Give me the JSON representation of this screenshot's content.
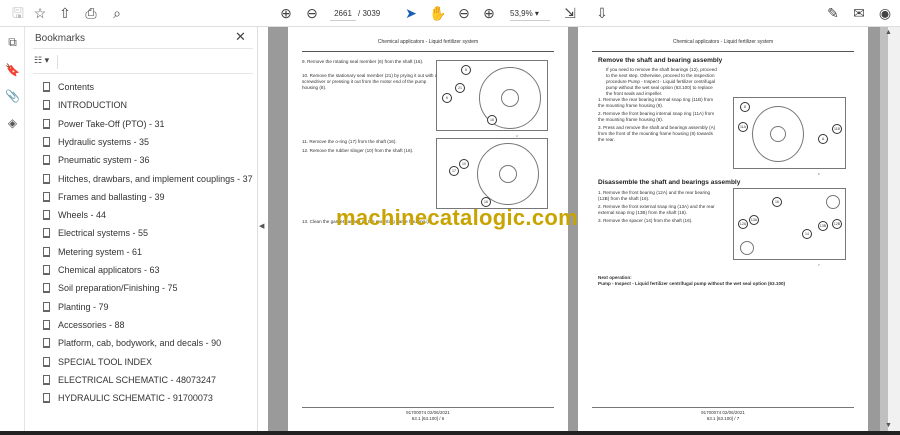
{
  "toolbar": {
    "page_current": "2661",
    "page_total": "/ 3039",
    "zoom": "53,9%"
  },
  "bookmarks": {
    "title": "Bookmarks",
    "items": [
      "Contents",
      "INTRODUCTION",
      "Power Take-Off (PTO) - 31",
      "Hydraulic systems - 35",
      "Pneumatic system - 36",
      "Hitches, drawbars, and implement couplings - 37",
      "Frames and ballasting - 39",
      "Wheels - 44",
      "Electrical systems - 55",
      "Metering system - 61",
      "Chemical applicators - 63",
      "Soil preparation/Finishing - 75",
      "Planting - 79",
      "Accessories - 88",
      "Platform, cab, bodywork, and decals - 90",
      "SPECIAL TOOL INDEX",
      "ELECTRICAL SCHEMATIC - 48073247",
      "HYDRAULIC SCHEMATIC - 91700073"
    ]
  },
  "page_left": {
    "header": "Chemical applicators - Liquid fertilizer system",
    "steps": [
      "9. Remove the rotating seal member (6) from the shaft (16).",
      "10. Remove the stationary seal member (21) by prying it out with a screwdriver or pressing it out from the motor end of the pump housing (8).",
      "11. Remove the o-ring (17) from the shaft (16).",
      "12. Remove the rubber slinger (10) from the shaft (16).",
      "13. Clean the gasket surface on the mounting frame housing (8)."
    ],
    "fig_nums": [
      "4",
      "5"
    ],
    "footer1": "91700074 02/06/2021",
    "footer2": "63.1 [63.100] / 6"
  },
  "page_right": {
    "header": "Chemical applicators - Liquid fertilizer system",
    "h1": "Remove the shaft and bearing assembly",
    "intro": "If you need to remove the shaft bearings (12), proceed to the next step. Otherwise, proceed to the inspection procedure Pump - Inspect - Liquid fertilizer centrifugal pump without the wet seal option (63.100) to replace the front seals and impeller.",
    "steps1": [
      "1. Remove the rear bearing internal snap ring (11B) from the mounting frame housing (8).",
      "2. Remove the front bearing internal snap ring (11A) from the mounting frame housing (8).",
      "3. Press and remove the shaft and bearings assembly (A) from the front of the mounting frame housing (8) towards the rear."
    ],
    "h2": "Disassemble the shaft and bearings assembly",
    "steps2": [
      "1. Remove the front bearing (12A) and the rear bearing (12B) from the shaft (16).",
      "2. Remove the front external snap ring (13A) and the rear external snap ring (13B) from the shaft (16).",
      "3. Remove the spacer (14) from the shaft (16)."
    ],
    "next_label": "Next operation:",
    "next_text": "Pump - Inspect - Liquid fertilizer centrifugal pump without the wet seal option (63.100)",
    "fig_nums": [
      "6",
      "7"
    ],
    "footer1": "91700074 02/06/2021",
    "footer2": "63.1 [63.100] / 7"
  },
  "watermark": "machinecatalogic.com"
}
